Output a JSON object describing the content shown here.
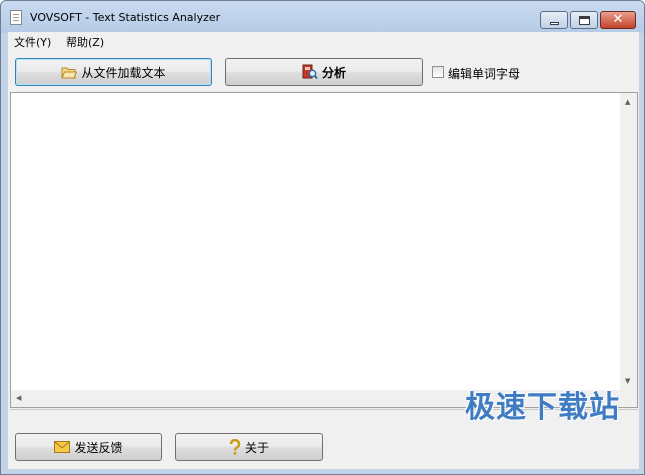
{
  "window": {
    "title": "VOVSOFT - Text Statistics Analyzer",
    "close_glyph": "✕"
  },
  "menu": {
    "file": "文件(Y)",
    "help": "帮助(Z)"
  },
  "toolbar": {
    "load_button": "从文件加载文本",
    "analyze_button": "分析",
    "edit_words_checkbox": "编辑单词字母",
    "edit_words_checked": false
  },
  "text_area": {
    "content": ""
  },
  "footer": {
    "feedback_button": "发送反馈",
    "about_button": "关于",
    "watermark": "极速下载站"
  },
  "icons": {
    "title": "document-icon",
    "load": "folder-open-icon",
    "analyze": "book-magnifier-icon",
    "feedback": "envelope-icon",
    "about": "help-icon"
  },
  "colors": {
    "window_frame": "#c4d4e8",
    "close_button": "#c3412a",
    "focus_border": "#3c7fb1",
    "watermark": "#3f7cc4"
  }
}
